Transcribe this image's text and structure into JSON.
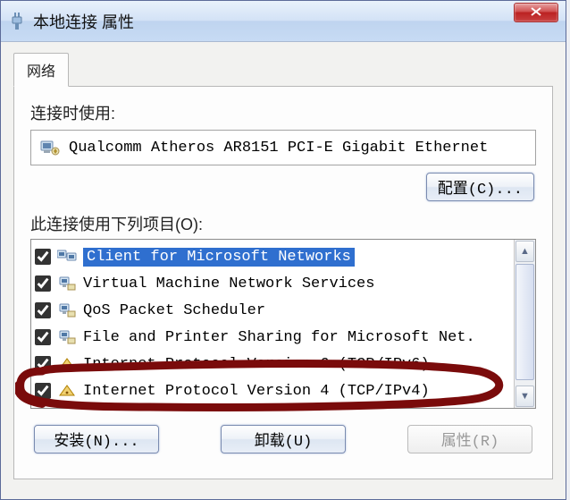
{
  "window": {
    "title": "本地连接 属性"
  },
  "tab": {
    "label": "网络"
  },
  "section_connect": {
    "label": "连接时使用:"
  },
  "adapter": {
    "name": "Qualcomm Atheros AR8151 PCI-E Gigabit Ethernet"
  },
  "buttons": {
    "configure": "配置(C)...",
    "install": "安装(N)...",
    "uninstall": "卸载(U)",
    "properties": "属性(R)"
  },
  "section_items": {
    "label": "此连接使用下列项目(O):"
  },
  "items": [
    {
      "label": "Client for Microsoft Networks",
      "checked": true,
      "icon": "net-client",
      "selected": true
    },
    {
      "label": "Virtual Machine Network Services",
      "checked": true,
      "icon": "svc",
      "selected": false
    },
    {
      "label": "QoS Packet Scheduler",
      "checked": true,
      "icon": "svc",
      "selected": false
    },
    {
      "label": "File and Printer Sharing for Microsoft Net.",
      "checked": true,
      "icon": "svc",
      "selected": false
    },
    {
      "label": "Internet Protocol Version 6 (TCP/IPv6)",
      "checked": true,
      "icon": "proto",
      "selected": false
    },
    {
      "label": "Internet Protocol Version 4 (TCP/IPv4)",
      "checked": true,
      "icon": "proto",
      "selected": false
    }
  ]
}
